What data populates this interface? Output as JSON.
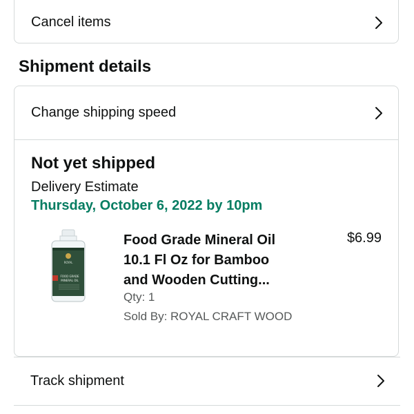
{
  "cancel": {
    "label": "Cancel items"
  },
  "shipment_section": {
    "title": "Shipment details"
  },
  "change_speed": {
    "label": "Change shipping speed"
  },
  "shipment": {
    "status": "Not yet shipped",
    "estimate_label": "Delivery Estimate",
    "estimate_date": "Thursday, October 6, 2022 by 10pm",
    "item": {
      "title": "Food Grade Mineral Oil 10.1 Fl Oz for Bamboo and Wooden Cutting...",
      "price": "$6.99",
      "qty": "Qty: 1",
      "seller": "Sold By: ROYAL CRAFT WOOD",
      "image_icon": "bottle-product-image",
      "bottle_label_lines": [
        "ROYAL",
        "FOOD GRADE",
        "MINERAL OIL"
      ]
    }
  },
  "track": {
    "label": "Track shipment"
  },
  "colors": {
    "accent_green": "#067d62",
    "border": "#d5d9d9",
    "text": "#0f1111",
    "muted": "#565959"
  }
}
